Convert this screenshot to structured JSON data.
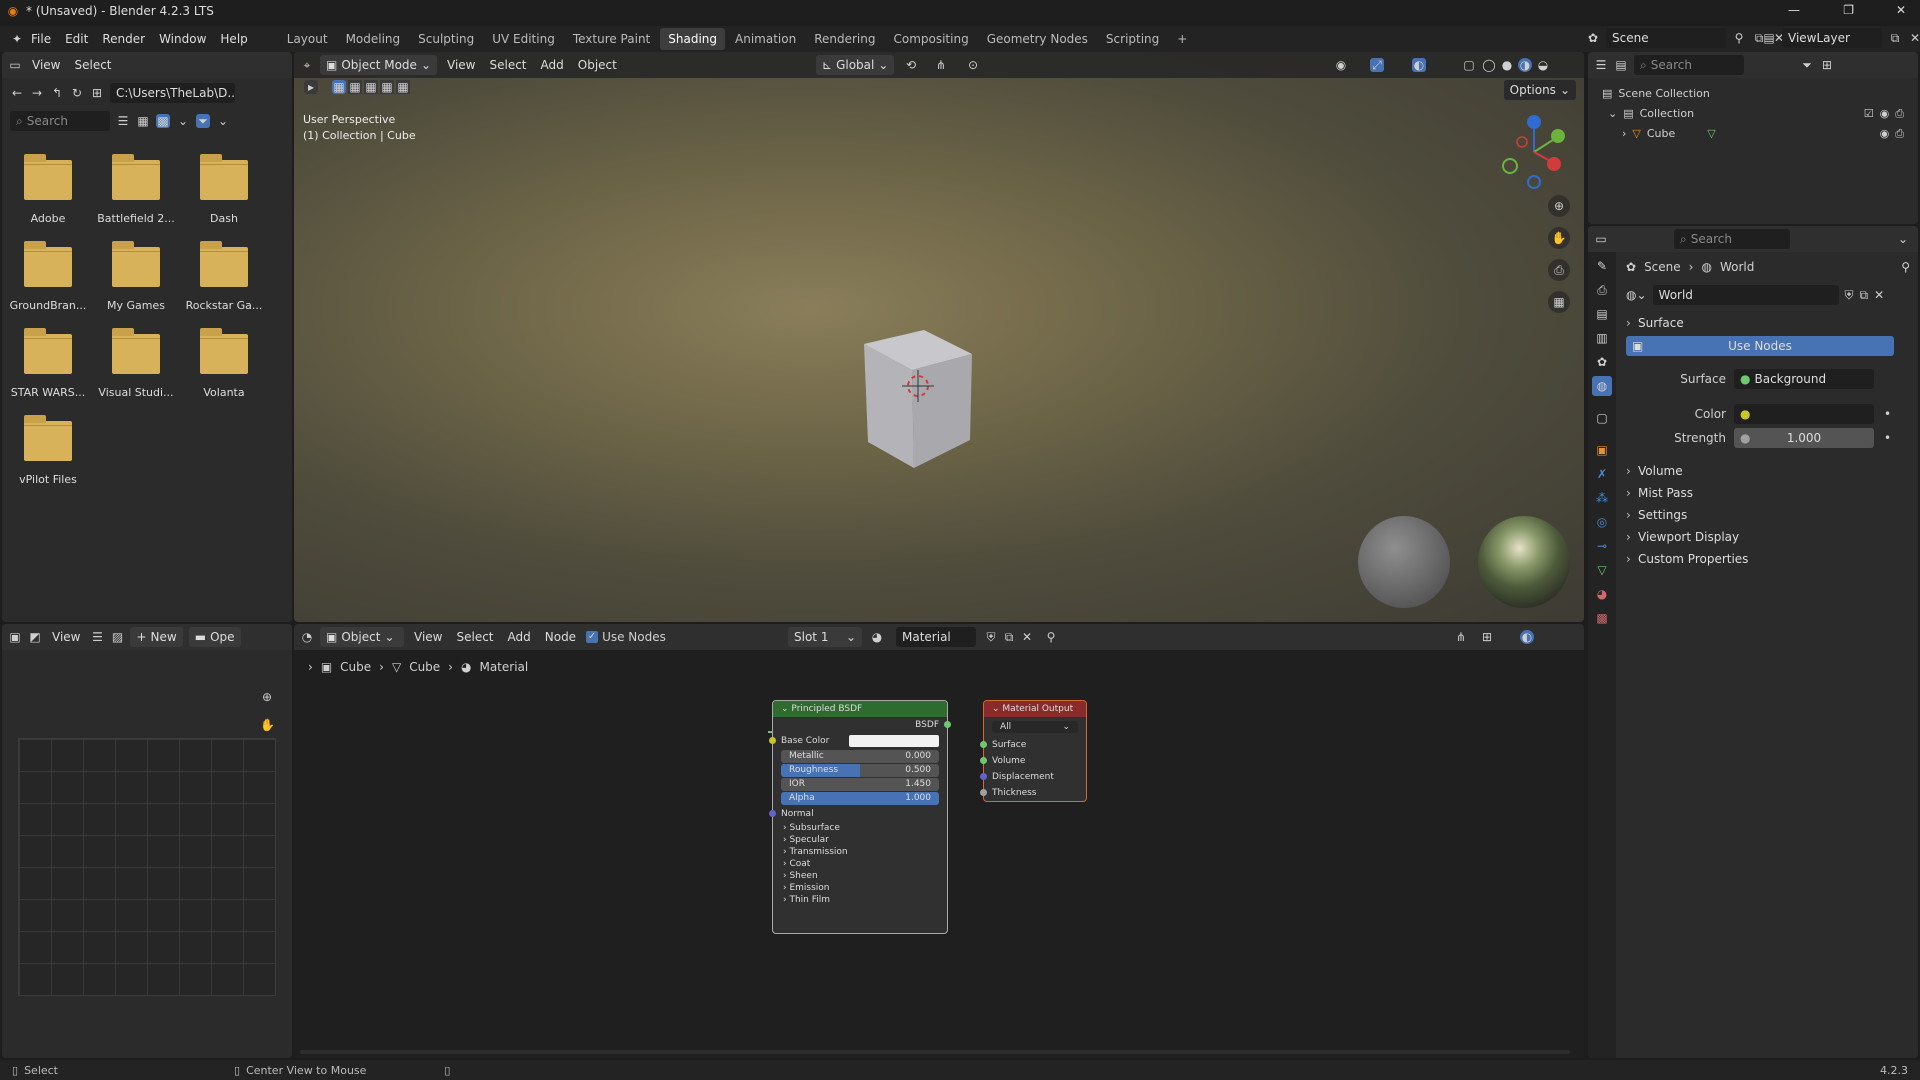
{
  "window": {
    "title": "* (Unsaved) - Blender 4.2.3 LTS",
    "min": "—",
    "max": "❐",
    "close": "✕"
  },
  "menu": {
    "file": "File",
    "edit": "Edit",
    "render": "Render",
    "window": "Window",
    "help": "Help"
  },
  "workspaces": [
    "Layout",
    "Modeling",
    "Sculpting",
    "UV Editing",
    "Texture Paint",
    "Shading",
    "Animation",
    "Rendering",
    "Compositing",
    "Geometry Nodes",
    "Scripting"
  ],
  "active_workspace": "Shading",
  "scene": {
    "name": "Scene",
    "view_layer": "ViewLayer"
  },
  "file_browser": {
    "view": "View",
    "select": "Select",
    "path": "C:\\Users\\TheLab\\D...",
    "search_placeholder": "Search",
    "folders": [
      "Adobe",
      "Battlefield 2...",
      "Dash",
      "GroundBran...",
      "My Games",
      "Rockstar Ga...",
      "STAR WARS...",
      "Visual Studi...",
      "Volanta",
      "vPilot Files"
    ]
  },
  "image_editor": {
    "view": "View",
    "new": "New",
    "open": "Ope"
  },
  "viewport": {
    "mode": "Object Mode",
    "view": "View",
    "select": "Select",
    "add": "Add",
    "object": "Object",
    "orientation": "Global",
    "options": "Options",
    "perspective": "User Perspective",
    "collection_info": "(1) Collection | Cube"
  },
  "node_editor": {
    "type": "Object",
    "view": "View",
    "select": "Select",
    "add": "Add",
    "node": "Node",
    "use_nodes": "Use Nodes",
    "slot": "Slot 1",
    "material": "Material",
    "breadcrumb": [
      "Cube",
      "Cube",
      "Material"
    ],
    "bsdf": {
      "title": "Principled BSDF",
      "output": "BSDF",
      "base_color": "Base Color",
      "metallic": {
        "label": "Metallic",
        "value": "0.000"
      },
      "roughness": {
        "label": "Roughness",
        "value": "0.500",
        "fill": 0.5
      },
      "ior": {
        "label": "IOR",
        "value": "1.450"
      },
      "alpha": {
        "label": "Alpha",
        "value": "1.000",
        "fill": 1.0
      },
      "normal": "Normal",
      "sections": [
        "Subsurface",
        "Specular",
        "Transmission",
        "Coat",
        "Sheen",
        "Emission",
        "Thin Film"
      ]
    },
    "output": {
      "title": "Material Output",
      "target": "All",
      "inputs": [
        "Surface",
        "Volume",
        "Displacement",
        "Thickness"
      ]
    }
  },
  "outliner": {
    "search_placeholder": "Search",
    "scene_collection": "Scene Collection",
    "collection": "Collection",
    "cube": "Cube"
  },
  "properties": {
    "search_placeholder": "Search",
    "breadcrumb_scene": "Scene",
    "breadcrumb_world": "World",
    "world_name": "World",
    "surface_section": "Surface",
    "use_nodes": "Use Nodes",
    "surface_label": "Surface",
    "surface_value": "Background",
    "color_label": "Color",
    "strength_label": "Strength",
    "strength_value": "1.000",
    "sections": [
      "Volume",
      "Mist Pass",
      "Settings",
      "Viewport Display",
      "Custom Properties"
    ]
  },
  "status": {
    "select": "Select",
    "center": "Center View to Mouse",
    "version": "4.2.3"
  },
  "colors": {
    "accent": "#4772b3",
    "folder": "#d8b25a",
    "node_bsdf": "#2e6b2e",
    "node_output": "#8a2a2a"
  }
}
